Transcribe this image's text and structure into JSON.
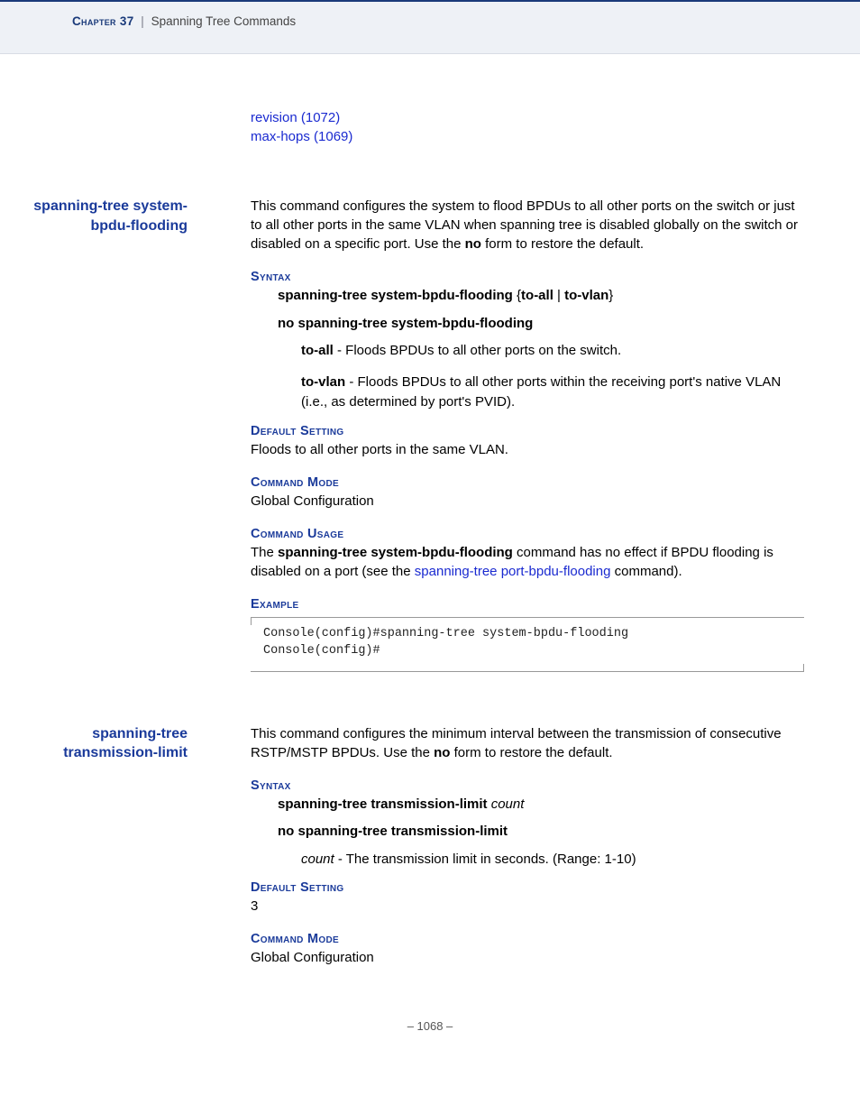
{
  "header": {
    "chapter": "Chapter 37",
    "separator": "|",
    "topic": "Spanning Tree Commands"
  },
  "top_links": {
    "link1": "revision (1072)",
    "link2": "max-hops (1069)"
  },
  "cmd1": {
    "name": "spanning-tree system-bpdu-flooding",
    "desc_pre": "This command configures the system to flood BPDUs to all other ports on the switch or just to all other ports in the same VLAN when spanning tree is disabled globally on the switch or disabled on a specific port. Use the ",
    "desc_bold": "no",
    "desc_post": " form to restore the default.",
    "syntax_head": "Syntax",
    "syntax_line1_a": "spanning-tree system-bpdu-flooding",
    "syntax_line1_b": " {",
    "syntax_line1_c": "to-all",
    "syntax_line1_d": " | ",
    "syntax_line1_e": "to-vlan",
    "syntax_line1_f": "}",
    "syntax_line2": "no spanning-tree system-bpdu-flooding",
    "opt1_name": "to-all",
    "opt1_desc": " - Floods BPDUs to all other ports on the switch.",
    "opt2_name": "to-vlan",
    "opt2_desc": " - Floods BPDUs to all other ports within the receiving port's native VLAN (i.e., as determined by port's PVID).",
    "default_head": "Default Setting",
    "default_text": "Floods to all other ports in the same VLAN.",
    "mode_head": "Command Mode",
    "mode_text": "Global Configuration",
    "usage_head": "Command Usage",
    "usage_pre": "The ",
    "usage_bold": "spanning-tree system-bpdu-flooding",
    "usage_mid": " command has no effect if BPDU flooding is disabled on a port (see the ",
    "usage_link": "spanning-tree port-bpdu-flooding",
    "usage_post": " command).",
    "example_head": "Example",
    "example_code": "Console(config)#spanning-tree system-bpdu-flooding\nConsole(config)#"
  },
  "cmd2": {
    "name": "spanning-tree transmission-limit",
    "desc_pre": "This command configures the minimum interval between the transmission of consecutive RSTP/MSTP BPDUs. Use the ",
    "desc_bold": "no",
    "desc_post": " form to restore the default.",
    "syntax_head": "Syntax",
    "syntax_line1_a": "spanning-tree transmission-limit",
    "syntax_line1_b": " count",
    "syntax_line2": "no spanning-tree transmission-limit",
    "opt1_name": "count",
    "opt1_desc": " - The transmission limit in seconds. (Range: 1-10)",
    "default_head": "Default Setting",
    "default_text": "3",
    "mode_head": "Command Mode",
    "mode_text": "Global Configuration"
  },
  "footer": {
    "page": "–  1068  –"
  }
}
